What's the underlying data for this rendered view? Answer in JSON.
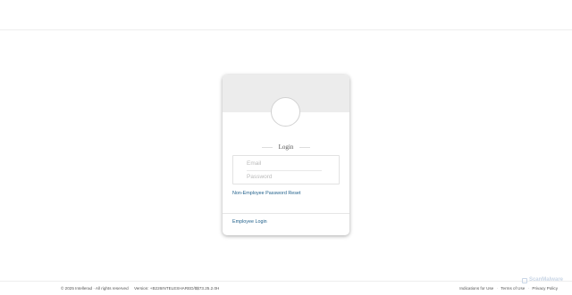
{
  "login": {
    "title": "Login",
    "email_placeholder": "Email",
    "password_placeholder": "Password",
    "reset_link": "Non-Employee Password Reset",
    "employee_link": "Employee Login"
  },
  "footer": {
    "copyright": "© 2025 Intellerad · All rights reserved",
    "version": "Version: +B226INTELESHARED/$$73.25.2.0H",
    "links": [
      "Indications for Use",
      "Terms of Use",
      "Privacy Policy"
    ]
  },
  "watermark": {
    "text": "ScanMalware",
    "icon": "shield-icon"
  },
  "colors": {
    "header_gray": "#ececec",
    "link_blue": "#1f5f8a"
  }
}
